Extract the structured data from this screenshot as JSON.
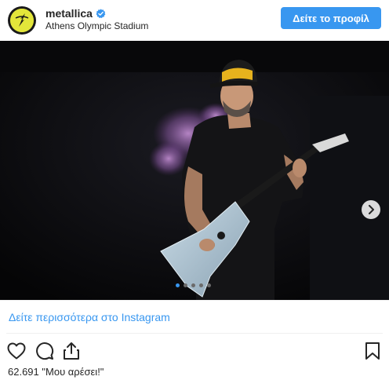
{
  "post": {
    "username": "metallica",
    "location": "Athens Olympic Stadium",
    "profile_button": "Δείτε το προφίλ",
    "more_link": "Δείτε περισσότερα στο Instagram",
    "likes_count": "62.691",
    "likes_label": "\"Μου αρέσει!\""
  },
  "carousel": {
    "slides": 5,
    "active_index": 0
  },
  "colors": {
    "accent": "#3897f0",
    "avatar_bg": "#e3e63a",
    "text": "#262626"
  },
  "icons": [
    "verified-badge-icon",
    "chevron-right-icon",
    "heart-icon",
    "comment-icon",
    "share-icon",
    "bookmark-icon",
    "metallica-logo-icon"
  ]
}
